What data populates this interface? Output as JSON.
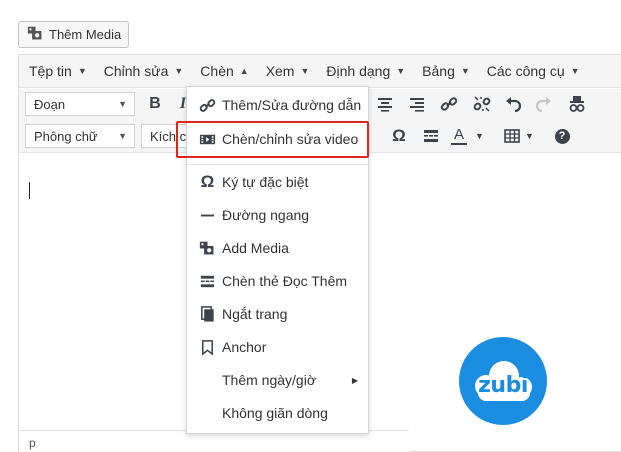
{
  "media_button": {
    "label": "Thêm Media"
  },
  "menubar": {
    "items": [
      {
        "label": "Tệp tin",
        "caret": "▼"
      },
      {
        "label": "Chỉnh sửa",
        "caret": "▼"
      },
      {
        "label": "Chèn",
        "caret": "▲"
      },
      {
        "label": "Xem",
        "caret": "▼"
      },
      {
        "label": "Định dạng",
        "caret": "▼"
      },
      {
        "label": "Bảng",
        "caret": "▼"
      },
      {
        "label": "Các công cụ",
        "caret": "▼"
      }
    ]
  },
  "toolbar": {
    "format_select": "Đoạn",
    "font_select": "Phông chữ",
    "size_select": "Kích cỡ",
    "bold": "B",
    "italic": "I",
    "omega": "Ω",
    "text_color": "A",
    "help": "?"
  },
  "dropdown": {
    "items": [
      {
        "label": "Thêm/Sửa đường dẫn",
        "icon": "link-icon"
      },
      {
        "label": "Chèn/chỉnh sửa video",
        "icon": "video-icon"
      },
      {
        "label": "Ký tự đặc biệt",
        "icon": "omega-icon"
      },
      {
        "label": "Đường ngang",
        "icon": "horizontal-line-icon"
      },
      {
        "label": "Add Media",
        "icon": "media-icon"
      },
      {
        "label": "Chèn thẻ Đọc Thêm",
        "icon": "read-more-icon"
      },
      {
        "label": "Ngắt trang",
        "icon": "page-break-icon"
      },
      {
        "label": "Anchor",
        "icon": "bookmark-icon"
      },
      {
        "label": "Thêm ngày/giờ",
        "icon": ""
      },
      {
        "label": "Không giãn dòng",
        "icon": ""
      }
    ],
    "submenu_arrow": "▶"
  },
  "statusbar": {
    "path": "p"
  },
  "watermark": {
    "text": "zubi"
  },
  "colors": {
    "highlight": "#e02424",
    "logo": "#1a8de0"
  }
}
